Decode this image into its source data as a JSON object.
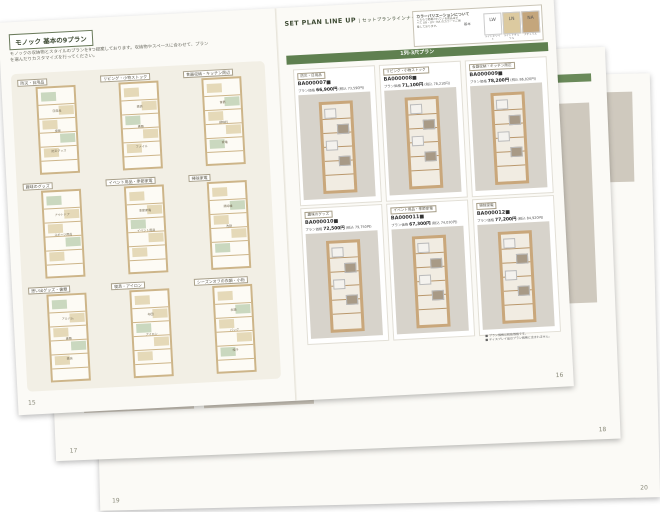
{
  "back_pages": {
    "page_17": "17",
    "page_18": "18",
    "page_19": "19",
    "page_20": "20"
  },
  "left_page": {
    "title": "モノック 基本の9プラン",
    "intro": "モノックの収納物とスタイルのプランを9つ提案しております。収納物やスペースに合わせて、プランを選んだりカスタマイズを行ってください。",
    "page_number": "15",
    "cells": [
      {
        "label": "防災・日用品",
        "tags": [
          "日用品",
          "掃除",
          "防災グッズ"
        ]
      },
      {
        "label": "リビング・小物ストック",
        "tags": [
          "雑貨",
          "書類",
          "ファイル"
        ]
      },
      {
        "label": "食器収納・キッチン周辺",
        "tags": [
          "食器",
          "調味料",
          "家電"
        ]
      },
      {
        "label": "趣味のグッズ",
        "tags": [
          "アウトドア",
          "スポーツ用品"
        ]
      },
      {
        "label": "イベント用品・季節家電",
        "tags": [
          "季節家電",
          "イベント用品"
        ]
      },
      {
        "label": "掃除家電",
        "tags": [
          "掃除機",
          "洗剤"
        ]
      },
      {
        "label": "思い出グッズ・書類",
        "tags": [
          "アルバム",
          "書類",
          "雑誌"
        ]
      },
      {
        "label": "寝具・アイロン",
        "tags": [
          "布団",
          "アイロン"
        ]
      },
      {
        "label": "シーズンオフの衣類・小物",
        "tags": [
          "衣類",
          "バッグ",
          "帽子"
        ]
      }
    ]
  },
  "right_page": {
    "header_main": "SET PLAN LINE UP",
    "header_sub": "セットプランラインナップ",
    "page_number": "16",
    "color_variation": {
      "title": "カラーバリエーションについて",
      "text": "こちらで掲載されている商品はすべて LW・LN・NA のカラーでご用意しております。",
      "swatches": [
        {
          "code": "LW",
          "sub": "ライトホワイト",
          "color": "#ffffff"
        },
        {
          "code": "LN",
          "sub": "ライトナチュラル",
          "color": "#dccaa0"
        },
        {
          "code": "NA",
          "sub": "ナチュラル",
          "color": "#c4a67c"
        }
      ],
      "lead": "基本"
    },
    "band": "1列-3尺プラン",
    "products": [
      {
        "label": "防災・日用品",
        "code": "BA000007■",
        "price_prefix": "プラン価格",
        "price": "66,900円",
        "price_tax": "(税込 73,590円)"
      },
      {
        "label": "リビング・小物ストック",
        "code": "BA000008■",
        "price_prefix": "プラン価格",
        "price": "71,100円",
        "price_tax": "(税込 78,210円)"
      },
      {
        "label": "食器収納・キッチン周辺",
        "code": "BA000009■",
        "price_prefix": "プラン価格",
        "price": "78,200円",
        "price_tax": "(税込 86,020円)"
      },
      {
        "label": "趣味のグッズ",
        "code": "BA000010■",
        "price_prefix": "プラン価格",
        "price": "72,500円",
        "price_tax": "(税込 79,750円)"
      },
      {
        "label": "イベント用品・季節家電",
        "code": "BA000011■",
        "price_prefix": "プラン価格",
        "price": "67,300円",
        "price_tax": "(税込 74,030円)"
      },
      {
        "label": "掃除家電",
        "code": "BA000012■",
        "price_prefix": "プラン価格",
        "price": "77,200円",
        "price_tax": "(税込 84,920円)"
      }
    ],
    "note_1": "■ プラン価格は税抜価格です。",
    "note_2": "■ ディスプレイ品はプラン価格に含まれません。"
  }
}
